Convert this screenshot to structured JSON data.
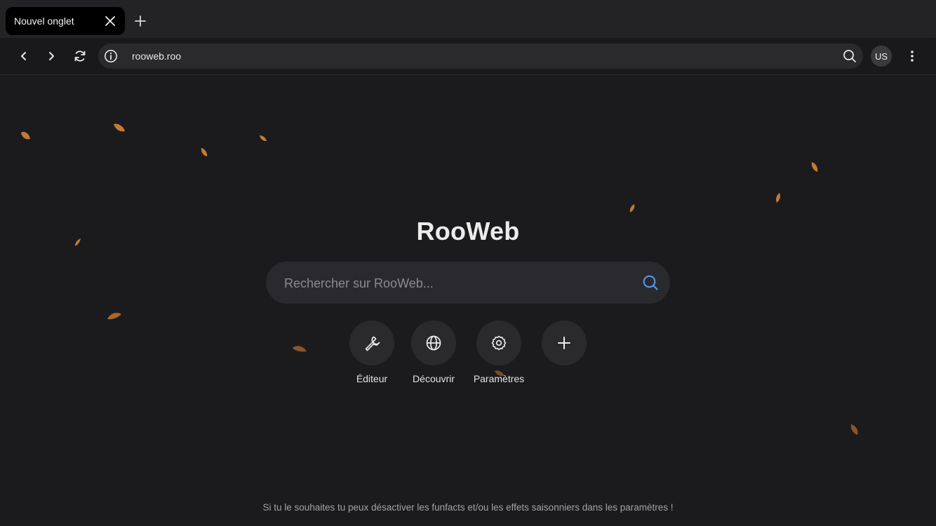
{
  "tab": {
    "title": "Nouvel onglet"
  },
  "toolbar": {
    "url": "rooweb.roo",
    "avatar_initials": "US"
  },
  "page": {
    "logo": "RooWeb",
    "search": {
      "placeholder": "Rechercher sur RooWeb...",
      "value": ""
    },
    "shortcuts": [
      {
        "label": "Éditeur",
        "icon": "wrench-icon"
      },
      {
        "label": "Découvrir",
        "icon": "globe-icon"
      },
      {
        "label": "Paramètres",
        "icon": "gear-icon"
      },
      {
        "label": "",
        "icon": "plus-icon"
      }
    ],
    "footer": "Si tu le souhaites tu peux désactiver les funfacts et/ou les effets saisonniers dans les paramètres !"
  },
  "colors": {
    "background": "#1b1b1d",
    "accent": "#5b9bf0",
    "leaf": "#c47a35"
  },
  "decor": {
    "effect": "autumn falling leaves"
  }
}
